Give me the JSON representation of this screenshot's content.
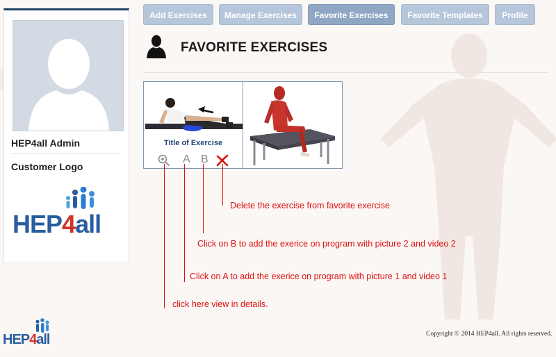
{
  "sidebar": {
    "admin_name": "HEP4all Admin",
    "customer_logo_label": "Customer Logo",
    "logo_text_hep": "HEP",
    "logo_text_4": "4",
    "logo_text_all": "all"
  },
  "nav": {
    "items": [
      {
        "label": "Add Exercises"
      },
      {
        "label": "Manage Exercises"
      },
      {
        "label": "Favorite Exercises"
      },
      {
        "label": "Favorite Templates"
      },
      {
        "label": "Profile"
      }
    ],
    "active": "Favorite Exercises"
  },
  "page": {
    "title": "FAVORITE EXERCISES"
  },
  "exercises": [
    {
      "title": "Title of Exercise",
      "actions": {
        "zoom_icon": "magnifier-plus-icon",
        "a_label": "A",
        "b_label": "B",
        "delete_icon": "red-x-icon"
      }
    },
    {
      "title": ""
    }
  ],
  "annotations": {
    "delete": "Delete the exercise from favorite exercise",
    "b": "Click on B to add the exerice on program with picture 2 and video 2",
    "a": "Click on A to add the exerice on program with picture 1 and video 1",
    "details": "click here view in details."
  },
  "footer": {
    "copyright": "Copyright © 2014 HEP4all. All rights reserved.",
    "logo_text_hep": "HEP",
    "logo_text_4": "4",
    "logo_text_all": "all"
  },
  "colors": {
    "nav_button": "#b6c6db",
    "nav_button_active": "#8fa7c3",
    "annotation": "#dd1111",
    "logo_blue": "#2a5d9f",
    "logo_red": "#d0332a",
    "sidebar_top_border": "#1f3f63"
  }
}
